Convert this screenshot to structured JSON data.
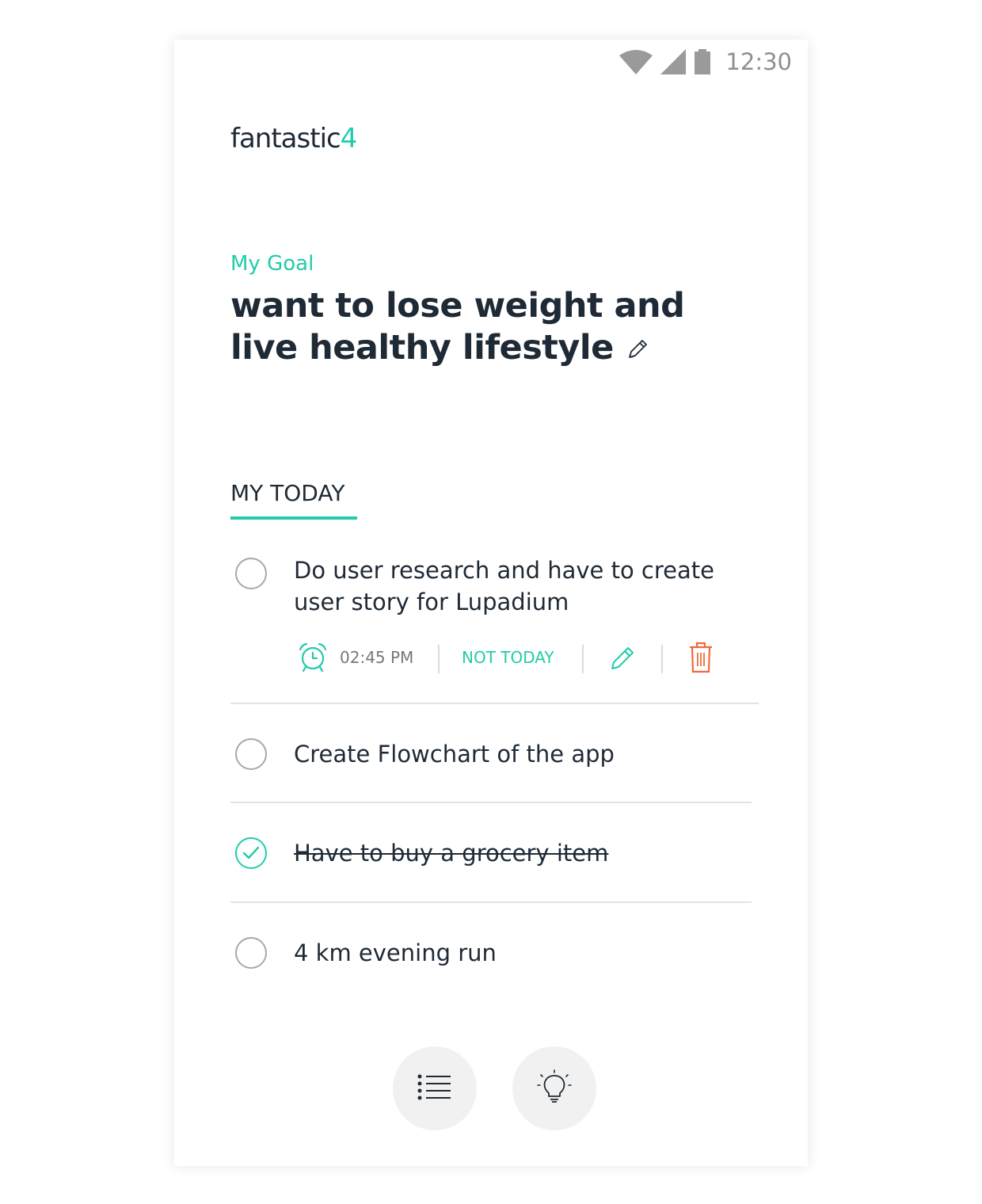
{
  "status_bar": {
    "time": "12:30",
    "icons": [
      "wifi-icon",
      "signal-icon",
      "battery-icon"
    ]
  },
  "app": {
    "logo_text": "fantastic",
    "logo_accent": "4"
  },
  "goal": {
    "label": "My Goal",
    "text": "want to lose weight and live healthy lifestyle",
    "edit_icon": "pencil-icon"
  },
  "tab": {
    "label": "MY TODAY"
  },
  "tasks": [
    {
      "title": "Do user research and have to create user story for Lupadium",
      "done": false,
      "expanded": true,
      "time": "02:45 PM",
      "not_today_label": "NOT TODAY",
      "actions": [
        "alarm-icon",
        "edit-icon",
        "delete-icon"
      ]
    },
    {
      "title": "Create Flowchart of the app",
      "done": false
    },
    {
      "title": "Have to buy a grocery item",
      "done": true
    },
    {
      "title": "4 km evening run",
      "done": false
    }
  ],
  "bottom_actions": [
    "list-icon",
    "lightbulb-icon"
  ],
  "colors": {
    "accent": "#22ccaa",
    "text": "#1e2a36",
    "delete": "#f06a3a",
    "muted": "#777777"
  }
}
